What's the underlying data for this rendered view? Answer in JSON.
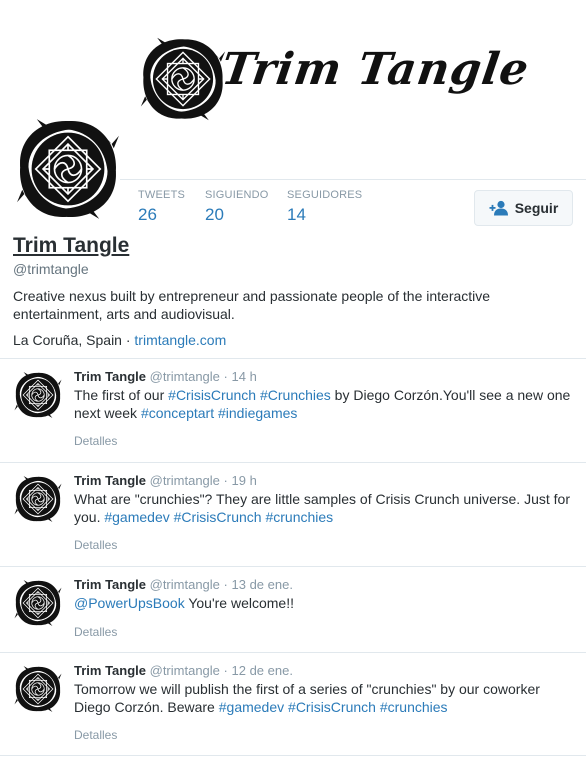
{
  "banner": {
    "title": "Trim Tangle",
    "logo_icon": "trim-tangle-logo"
  },
  "profile": {
    "name": "Trim Tangle",
    "handle": "@trimtangle",
    "bio": "Creative nexus built by entrepreneur and passionate people of the interactive entertainment, arts and audiovisual.",
    "location": "La Coruña, Spain",
    "separator": "·",
    "website": "trimtangle.com"
  },
  "stats": [
    {
      "label": "TWEETS",
      "value": "26"
    },
    {
      "label": "SIGUIENDO",
      "value": "20"
    },
    {
      "label": "SEGUIDORES",
      "value": "14"
    }
  ],
  "follow_button": {
    "label": "Seguir",
    "icon": "add-user-icon"
  },
  "tweets": [
    {
      "name": "Trim Tangle",
      "handle": "@trimtangle",
      "dot": "·",
      "time": "14 h",
      "t": [
        "The first of our ",
        "#CrisisCrunch",
        " ",
        "#Crunchies",
        " by Diego Corzón.You'll see a new one next week ",
        "#conceptart",
        " ",
        "#indiegames"
      ],
      "details": "Detalles"
    },
    {
      "name": "Trim Tangle",
      "handle": "@trimtangle",
      "dot": "·",
      "time": "19 h",
      "t": [
        "What are \"crunchies\"? They are little samples of Crisis Crunch universe. Just for you. ",
        "#gamedev",
        " ",
        "#CrisisCrunch",
        " ",
        "#crunchies"
      ],
      "details": "Detalles"
    },
    {
      "name": "Trim Tangle",
      "handle": "@trimtangle",
      "dot": "·",
      "time": "13 de ene.",
      "t": [
        "@PowerUpsBook",
        " You're welcome!!"
      ],
      "details": "Detalles"
    },
    {
      "name": "Trim Tangle",
      "handle": "@trimtangle",
      "dot": "·",
      "time": "12 de ene.",
      "t": [
        "Tomorrow we will publish the first of a series of \"crunchies\" by our coworker Diego Corzón. Beware ",
        "#gamedev",
        " ",
        "#CrisisCrunch",
        " ",
        "#crunchies"
      ],
      "details": "Detalles"
    }
  ],
  "colors": {
    "link": "#2b7bb9",
    "muted": "#8899a6",
    "text": "#292f33",
    "border": "#e1e8ed"
  }
}
